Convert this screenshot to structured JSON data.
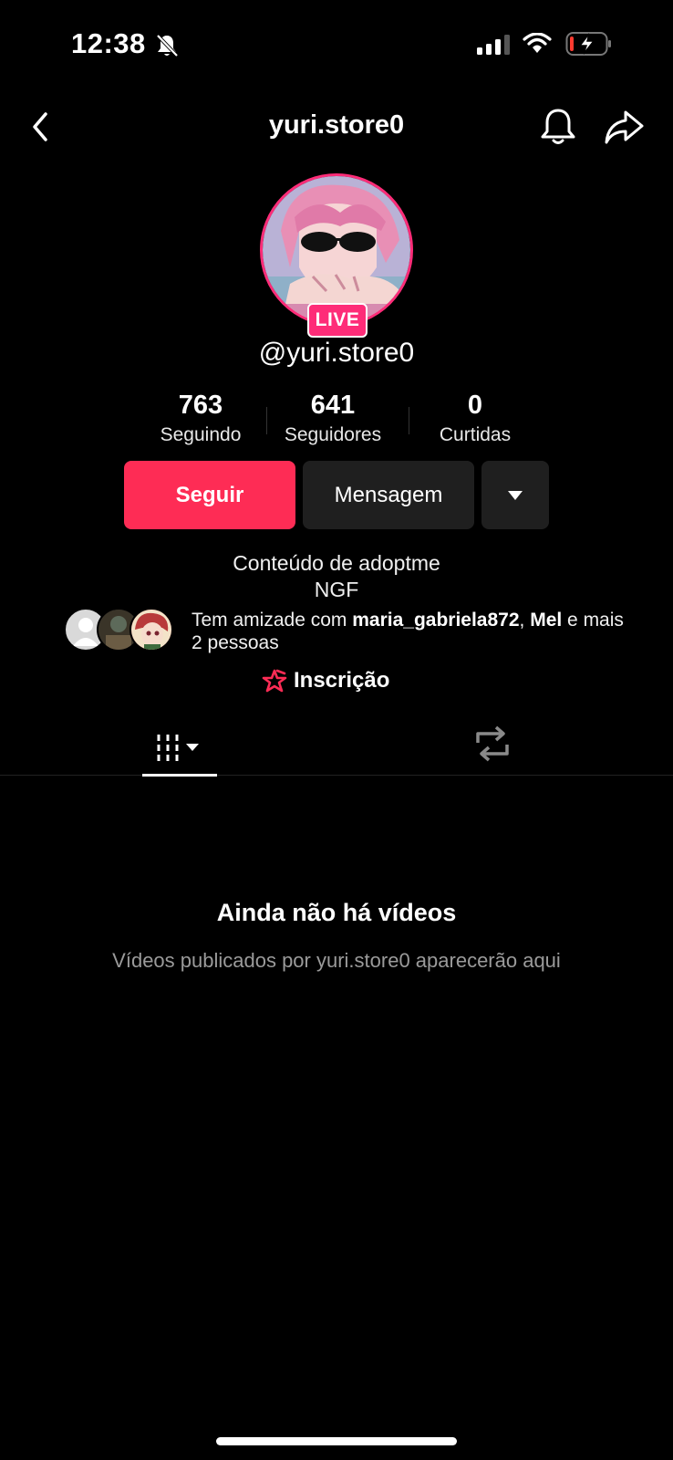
{
  "status_bar": {
    "time": "12:38"
  },
  "header": {
    "title": "yuri.store0"
  },
  "profile": {
    "live_label": "LIVE",
    "handle": "@yuri.store0",
    "stats": [
      {
        "value": "763",
        "label": "Seguindo"
      },
      {
        "value": "641",
        "label": "Seguidores"
      },
      {
        "value": "0",
        "label": "Curtidas"
      }
    ],
    "buttons": {
      "follow": "Seguir",
      "message": "Mensagem"
    },
    "bio_lines": [
      "Conteúdo de adoptme",
      "NGF"
    ],
    "friends": {
      "prefix": "Tem amizade com ",
      "name1": "maria_gabriela872",
      "sep": ", ",
      "name2": "Mel",
      "suffix": " e mais 2 pessoas"
    },
    "signup_label": "Inscrição"
  },
  "empty_state": {
    "title": "Ainda não há vídeos",
    "subtitle": "Vídeos publicados por yuri.store0 aparecerão aqui"
  },
  "colors": {
    "accent": "#fe2c55",
    "live": "#fe2c78",
    "button_dark": "#1f1f1f"
  }
}
